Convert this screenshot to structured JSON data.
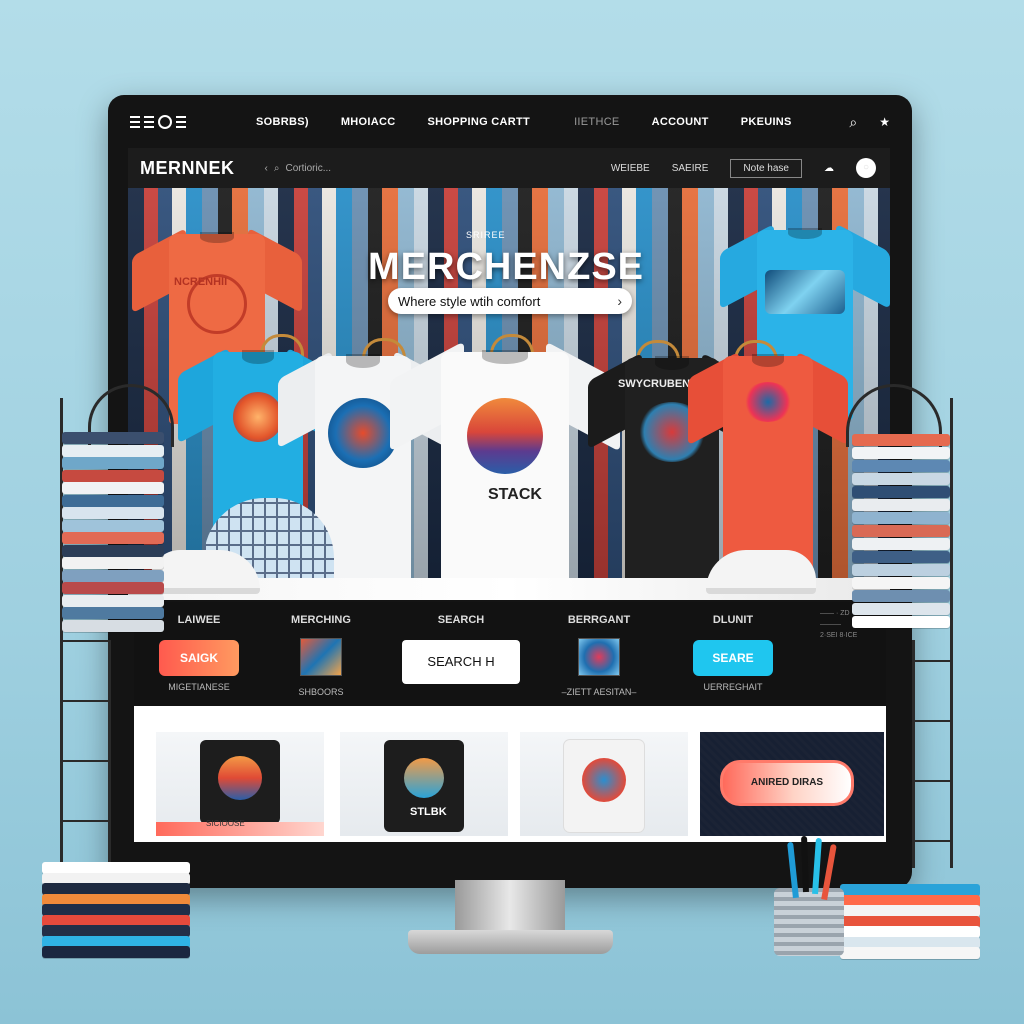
{
  "topnav": {
    "links": [
      "SOBRBS)",
      "MHOIACC",
      "SHOPPING CARTT",
      "IIETHCE",
      "ACCOUNT",
      "PKEUINS"
    ],
    "icons": [
      "menu-icon",
      "settings-icon",
      "search-icon",
      "star-icon"
    ]
  },
  "header": {
    "logo": "MERNNEK",
    "search_placeholder": "Cortioric...",
    "links": [
      "WEIEBE",
      "SAEIRE"
    ],
    "note_box": "Note hase"
  },
  "hero": {
    "tag": "SRIREE",
    "title": "MERCHENZSE",
    "tagline": "Where style wtih comfort",
    "tagline_arrow": "›",
    "center_tee_text": "STACK",
    "black_tee_text": "SWYCRUBENS",
    "left_tee_text": "NCRENHII"
  },
  "categories": [
    {
      "title": "LAIWEE",
      "button": "SAIGK",
      "caption": "MIGETIANESE"
    },
    {
      "title": "MERCHING",
      "caption": "SHBOORS"
    },
    {
      "title": "SEARCH",
      "button": "SEARCH H"
    },
    {
      "title": "BERRGANT",
      "caption": "–ZIETT AESITAN–"
    },
    {
      "title": "DLUNIT",
      "button": "SEARE",
      "caption": "UERREGHAIT"
    }
  ],
  "side_info": {
    "lines": [
      "—— · ZD",
      "———",
      "2·SEI 8·ICE"
    ]
  },
  "products": [
    {
      "label": "SICIOOSE"
    },
    {
      "label": "STLBK"
    },
    {
      "label": ""
    }
  ],
  "promo": {
    "label": "ANIRED DIRAS"
  },
  "colors": {
    "accent_coral": "#ff6a5b",
    "accent_cyan": "#20c4ef",
    "monitor": "#141414",
    "background": "#a8d7e6"
  }
}
